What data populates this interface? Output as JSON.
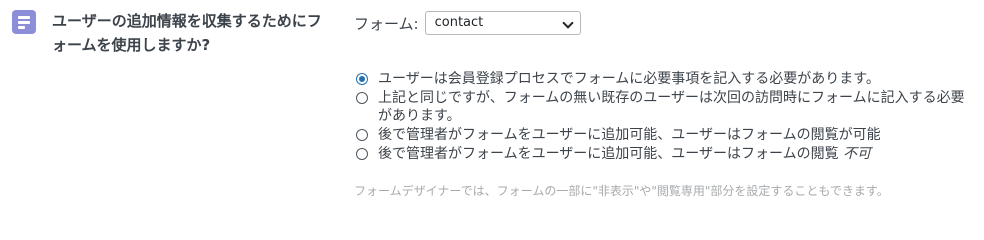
{
  "setting": {
    "icon": "form-layout-icon",
    "title": "ユーザーの追加情報を収集するためにフォームを使用しますか?"
  },
  "form_select": {
    "label": "フォーム:",
    "selected": "contact"
  },
  "options": [
    {
      "text": "ユーザーは会員登録プロセスでフォームに必要事項を記入する必要があります。",
      "checked": true
    },
    {
      "text": "上記と同じですが、フォームの無い既存のユーザーは次回の訪問時にフォームに記入する必要があります。",
      "checked": false
    },
    {
      "text": "後で管理者がフォームをユーザーに追加可能、ユーザーはフォームの閲覧が可能",
      "checked": false
    },
    {
      "text": "後で管理者がフォームをユーザーに追加可能、ユーザーはフォームの閲覧",
      "emphasis": "不可",
      "checked": false
    }
  ],
  "description": "フォームデザイナーでは、フォームの一部に\"非表示\"や\"閲覧専用\"部分を設定することもできます。",
  "colors": {
    "icon_bg": "#8c8fd8",
    "radio_accent": "#2271b1",
    "text": "#3c434a",
    "muted_text": "#a7aaad"
  }
}
